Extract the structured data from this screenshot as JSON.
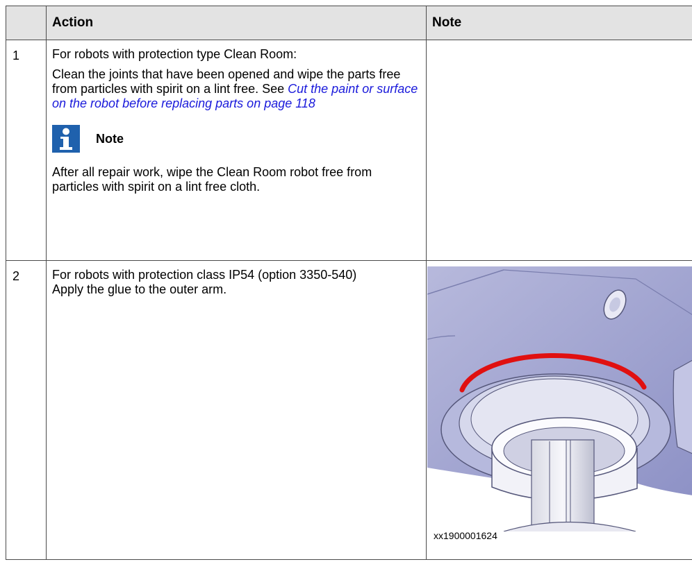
{
  "table": {
    "headers": {
      "number": "",
      "action": "Action",
      "note": "Note"
    },
    "rows": [
      {
        "number": "1",
        "intro": "For robots with protection type Clean Room:",
        "text": "Clean the joints that have been opened and wipe the parts free from particles with spirit on a lint free. See ",
        "link": "Cut the paint or surface on the robot before replacing parts on page 118",
        "note_label": "Note",
        "note_icon": "info-icon",
        "note_text": "After all repair work, wipe the Clean Room robot free from particles with spirit on a lint free cloth."
      },
      {
        "number": "2",
        "intro": "For robots with protection class IP54 (option 3350-540)",
        "text": "Apply the glue to the outer arm.",
        "figure_caption": "xx1900001624"
      }
    ]
  },
  "colors": {
    "header_bg": "#e3e3e3",
    "link": "#1a1adb",
    "icon_blue": "#1f61ad",
    "glue_red": "#e01010"
  }
}
